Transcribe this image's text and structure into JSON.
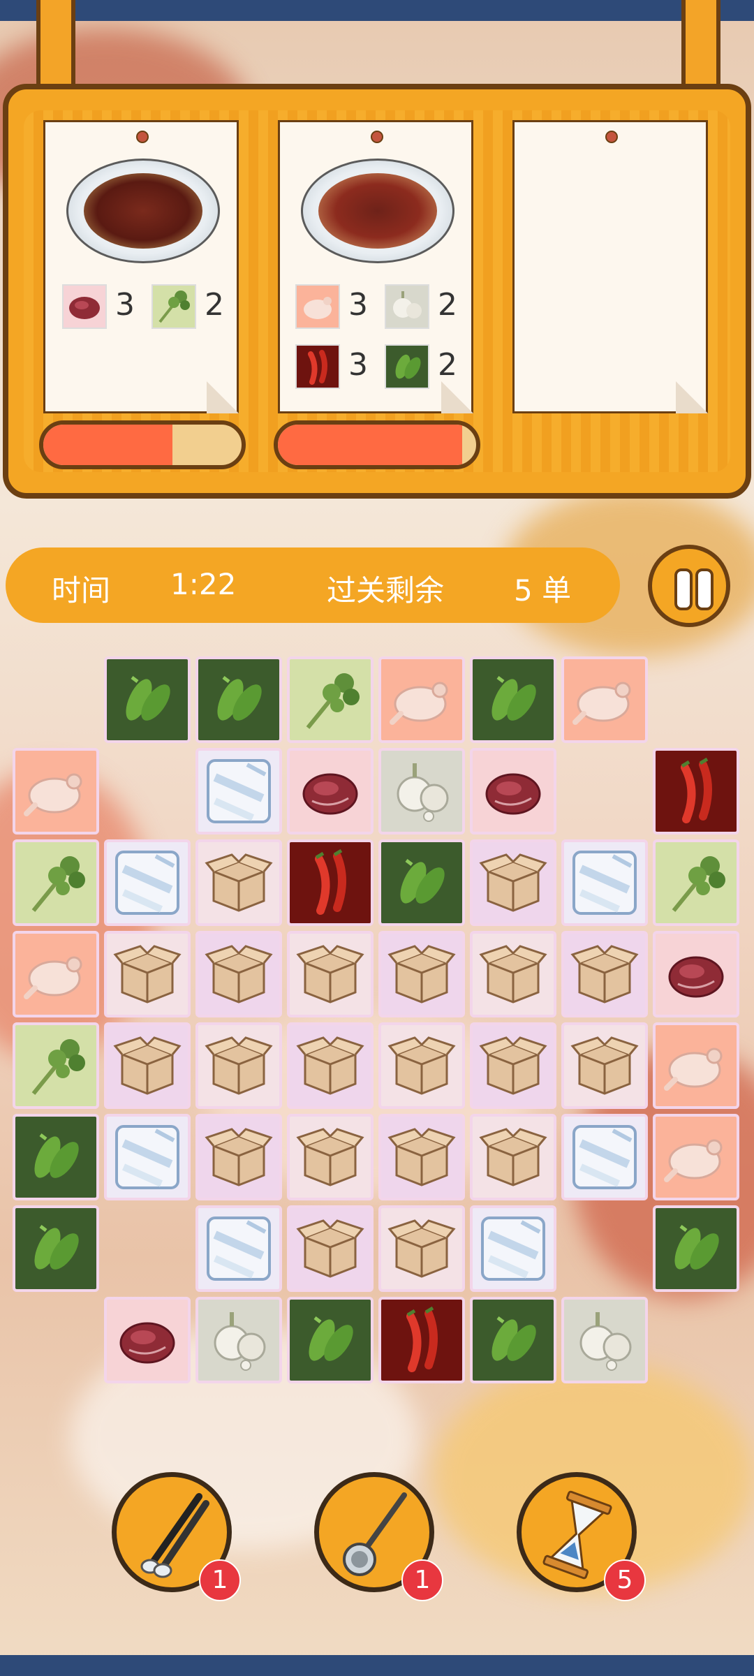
{
  "status": {
    "time_label": "时间",
    "time_value": "1:22",
    "remaining_label": "过关剩余",
    "remaining_value": "5 单"
  },
  "orders": [
    {
      "dish": "beef-with-cilantro",
      "ingredients": [
        {
          "icon": "beef-icon",
          "count": "3"
        },
        {
          "icon": "cilantro-icon",
          "count": "2"
        }
      ],
      "progress": 0.65
    },
    {
      "dish": "chicken-chili-stirfry",
      "ingredients": [
        {
          "icon": "chicken-icon",
          "count": "3"
        },
        {
          "icon": "garlic-icon",
          "count": "2"
        },
        {
          "icon": "chili-icon",
          "count": "3"
        },
        {
          "icon": "green-pepper-icon",
          "count": "2"
        }
      ],
      "progress": 0.93
    },
    {
      "dish": "empty",
      "ingredients": [],
      "progress": null
    }
  ],
  "board": {
    "rows": [
      [
        "",
        "pepper",
        "pepper",
        "cilantro",
        "chicken",
        "pepper",
        "chicken",
        ""
      ],
      [
        "chicken",
        "",
        "ice",
        "beef",
        "garlic",
        "beef",
        "",
        "chili"
      ],
      [
        "cilantro",
        "ice",
        "box",
        "chili",
        "pepper",
        "box",
        "ice",
        "cilantro"
      ],
      [
        "chicken",
        "box",
        "box",
        "box",
        "box",
        "box",
        "box",
        "beef"
      ],
      [
        "cilantro",
        "box",
        "box",
        "box",
        "box",
        "box",
        "box",
        "chicken"
      ],
      [
        "pepper",
        "ice",
        "box",
        "box",
        "box",
        "box",
        "ice",
        "chicken"
      ],
      [
        "pepper",
        "",
        "ice",
        "box",
        "box",
        "ice",
        "",
        "pepper"
      ],
      [
        "",
        "beef",
        "garlic",
        "pepper",
        "chili",
        "pepper",
        "garlic",
        ""
      ]
    ]
  },
  "tools": [
    {
      "name": "tongs",
      "count": "1"
    },
    {
      "name": "strainer",
      "count": "1"
    },
    {
      "name": "hourglass",
      "count": "5"
    }
  ],
  "colors": {
    "accent": "#f4a624",
    "outline": "#6b3f12",
    "bar_fill": "#ff6a42",
    "badge": "#e8373f"
  }
}
